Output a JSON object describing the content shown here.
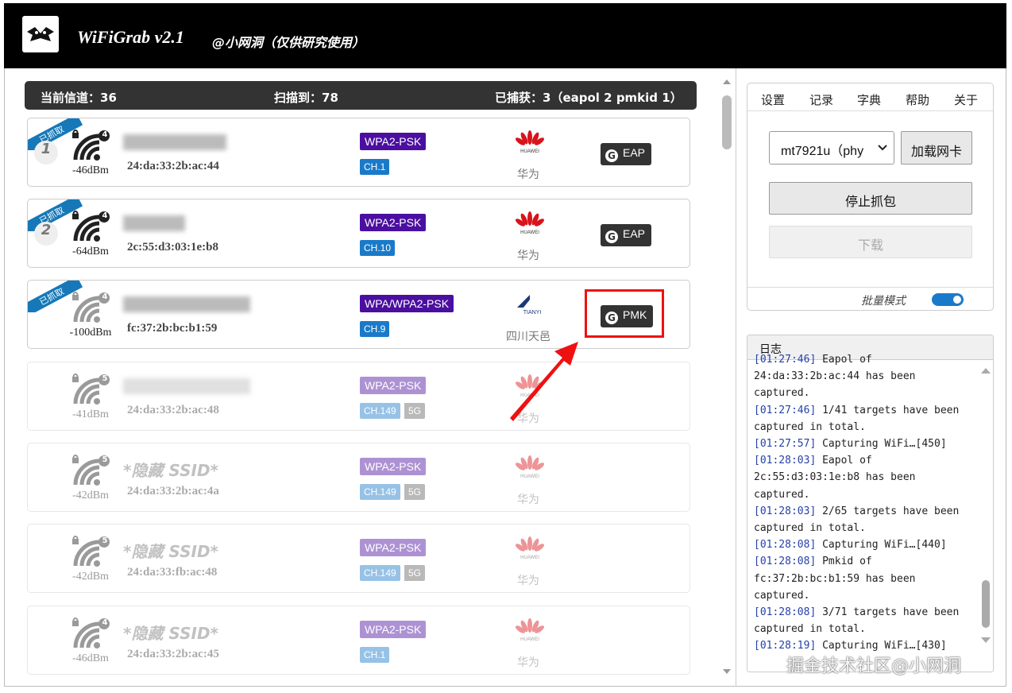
{
  "app": {
    "title": "WiFiGrab v2.1",
    "subtitle": "@小网洞（仅供研究使用）"
  },
  "status": {
    "channel_label": "当前信道：",
    "channel": "36",
    "scanned_label": "扫描到：",
    "scanned": "78",
    "captured_label": "已捕获：",
    "captured": "3（eapol 2  pmkid 1）"
  },
  "networks": [
    {
      "ribbon": "已抓取",
      "index": "1",
      "signal": "-46dBm",
      "clients": "4",
      "ssid": "",
      "mac": "24:da:33:2b:ac:44",
      "encryption": "WPA2-PSK",
      "channel": "CH.1",
      "band": "",
      "vendor": "华为",
      "vendor_logo": "huawei",
      "badge": "EAP"
    },
    {
      "ribbon": "已抓取",
      "index": "2",
      "signal": "-64dBm",
      "clients": "4",
      "ssid": "",
      "mac": "2c:55:d3:03:1e:b8",
      "encryption": "WPA2-PSK",
      "channel": "CH.10",
      "band": "",
      "vendor": "华为",
      "vendor_logo": "huawei",
      "badge": "EAP"
    },
    {
      "ribbon": "已抓取",
      "index": "",
      "signal": "-100dBm",
      "clients": "4",
      "ssid": "",
      "mac": "fc:37:2b:bc:b1:59",
      "encryption": "WPA/WPA2-PSK",
      "channel": "CH.9",
      "band": "",
      "vendor": "四川天邑",
      "vendor_logo": "tianyi",
      "badge": "PMK"
    },
    {
      "ribbon": "",
      "index": "",
      "signal": "-41dBm",
      "clients": "5",
      "ssid": "",
      "mac": "24:da:33:2b:ac:48",
      "encryption": "WPA2-PSK",
      "channel": "CH.149",
      "band": "5G",
      "vendor": "华为",
      "vendor_logo": "huawei",
      "badge": ""
    },
    {
      "ribbon": "",
      "index": "",
      "signal": "-42dBm",
      "clients": "5",
      "ssid": "*隐藏 SSID*",
      "mac": "24:da:33:2b:ac:4a",
      "encryption": "WPA2-PSK",
      "channel": "CH.149",
      "band": "5G",
      "vendor": "华为",
      "vendor_logo": "huawei",
      "badge": ""
    },
    {
      "ribbon": "",
      "index": "",
      "signal": "-42dBm",
      "clients": "5",
      "ssid": "*隐藏 SSID*",
      "mac": "24:da:33:fb:ac:48",
      "encryption": "WPA2-PSK",
      "channel": "CH.149",
      "band": "5G",
      "vendor": "华为",
      "vendor_logo": "huawei",
      "badge": ""
    },
    {
      "ribbon": "",
      "index": "",
      "signal": "-46dBm",
      "clients": "4",
      "ssid": "*隐藏 SSID*",
      "mac": "24:da:33:2b:ac:45",
      "encryption": "WPA2-PSK",
      "channel": "CH.1",
      "band": "",
      "vendor": "华为",
      "vendor_logo": "huawei",
      "badge": ""
    }
  ],
  "vendor_logo_text": {
    "huawei": "HUAWEI",
    "tianyi": "TIANYI"
  },
  "menu": {
    "settings": "设置",
    "records": "记录",
    "dictionary": "字典",
    "help": "帮助",
    "about": "关于"
  },
  "controls": {
    "adapter": "mt7921u（phy",
    "load_adapter": "加载网卡",
    "stop_capture": "停止抓包",
    "download": "下载",
    "batch_mode": "批量模式",
    "batch_on": true
  },
  "log": {
    "title": "日志",
    "lines": [
      {
        "ts": "[01:27:46]",
        "text": " Eapol of"
      },
      {
        "ts": "",
        "text": "24:da:33:2b:ac:44 has been"
      },
      {
        "ts": "",
        "text": "captured."
      },
      {
        "ts": "[01:27:46]",
        "text": " 1/41 targets have been"
      },
      {
        "ts": "",
        "text": "captured in total."
      },
      {
        "ts": "[01:27:57]",
        "text": " Capturing WiFi…[450]"
      },
      {
        "ts": "[01:28:03]",
        "text": " Eapol of"
      },
      {
        "ts": "",
        "text": "2c:55:d3:03:1e:b8 has been"
      },
      {
        "ts": "",
        "text": "captured."
      },
      {
        "ts": "[01:28:03]",
        "text": " 2/65 targets have been"
      },
      {
        "ts": "",
        "text": "captured in total."
      },
      {
        "ts": "[01:28:08]",
        "text": " Capturing WiFi…[440]"
      },
      {
        "ts": "[01:28:08]",
        "text": " Pmkid of"
      },
      {
        "ts": "",
        "text": "fc:37:2b:bc:b1:59 has been"
      },
      {
        "ts": "",
        "text": "captured."
      },
      {
        "ts": "[01:28:08]",
        "text": " 3/71 targets have been"
      },
      {
        "ts": "",
        "text": "captured in total."
      },
      {
        "ts": "[01:28:19]",
        "text": " Capturing WiFi…[430]"
      }
    ]
  },
  "watermark": "掘金技术社区@小网洞",
  "colors": {
    "wpa": "#4b0fa0",
    "channel": "#1a7ac9",
    "highlight": "#e11111",
    "timestamp": "#2541a8"
  }
}
